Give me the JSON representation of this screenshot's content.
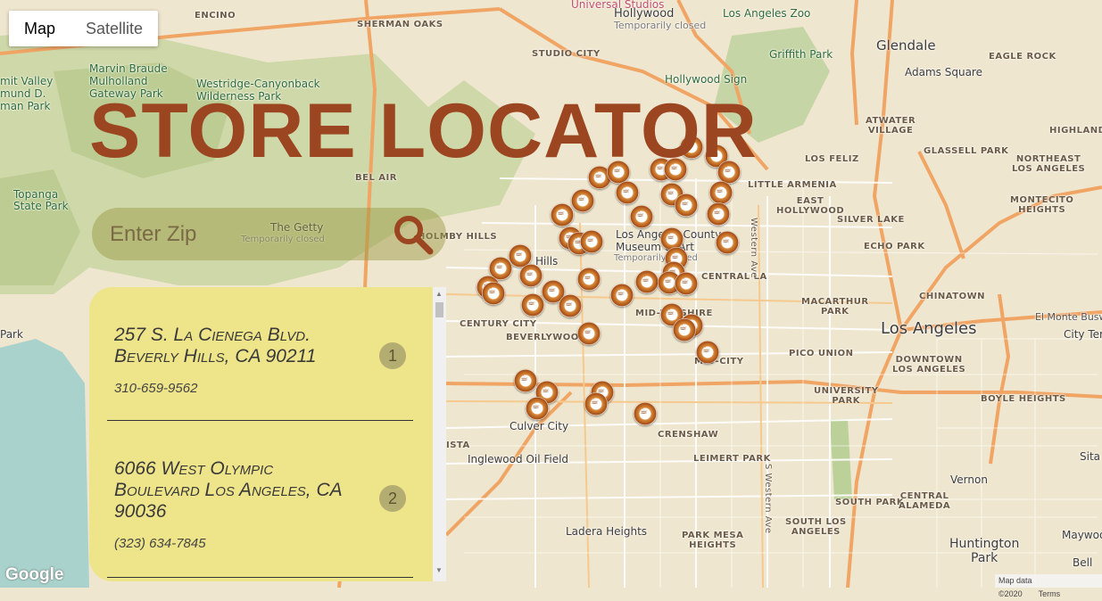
{
  "map_controls": {
    "map_label": "Map",
    "satellite_label": "Satellite"
  },
  "title": "STORE LOCATOR",
  "search": {
    "placeholder": "Enter Zip",
    "button_icon": "search-icon"
  },
  "stores": [
    {
      "address_line1": "257 S. La Cienega Blvd.",
      "address_line2": "Beverly Hills, CA 90211",
      "phone": "310-659-9562",
      "number": "1"
    },
    {
      "address_line1": "6066 West Olympic",
      "address_line2": "Boulevard Los Angeles, CA",
      "address_line3": "90036",
      "phone": "(323) 634-7845",
      "number": "2"
    }
  ],
  "map_labels": {
    "encino": "ENCINO",
    "sherman_oaks": "SHERMAN OAKS",
    "studio_city": "STUDIO CITY",
    "universal": "Universal Studios",
    "hollywood_top": "Hollywood",
    "temp_closed_1": "Temporarily closed",
    "la_zoo": "Los Angeles Zoo",
    "glendale": "Glendale",
    "eagle_rock": "EAGLE ROCK",
    "adams_square": "Adams Square",
    "griffith_park": "Griffith Park",
    "temp_closed_2": "Temporarily\nclosed",
    "hollywood_sign": "Hollywood Sign",
    "marvin_braude": "Marvin Braude\nMulholland\nGateway Park",
    "westridge": "Westridge-Canyonback\nWilderness Park",
    "summit_valley": "mit Valley\nmund D.\nman Park",
    "atwater": "ATWATER\nVILLAGE",
    "highland": "HIGHLAND",
    "glassell": "GLASSELL PARK",
    "northeast_la": "NORTHEAST\nLOS ANGELES",
    "bel_air": "BEL AIR",
    "los_feliz": "LOS FELIZ",
    "little_armenia": "LITTLE ARMENIA",
    "east_hollywood": "EAST\nHOLLYWOOD",
    "silver_lake": "SILVER LAKE",
    "montecito": "MONTECITO\nHEIGHTS",
    "topanga": "Topanga\nState Park",
    "getty": "The Getty",
    "temp_closed_3": "Temporarily closed",
    "holmby": "HOLMBY HILLS",
    "echo_park": "ECHO PARK",
    "lacma": "Los Angeles County\nMuseum of Art",
    "temp_closed_4": "Temporarily closed",
    "central_la": "CENTRAL LA",
    "western_ave": "Western Ave",
    "s_western_ave": "S Western Ave",
    "chinatown": "CHINATOWN",
    "macarthur": "MACARTHUR\nPARK",
    "century_city": "CENTURY CITY",
    "beverlywood": "BEVERLYWOOD",
    "mid_wilshire": "MID-WILSHIRE",
    "los_angeles": "Los Angeles",
    "el_monte_busway": "El Monte Busway",
    "city_terrace": "City Ter",
    "pico_union": "PICO UNION",
    "mid_city": "MID-CITY",
    "downtown": "DOWNTOWN\nLOS ANGELES",
    "university_park": "UNIVERSITY\nPARK",
    "boyle_heights": "BOYLE HEIGHTS",
    "culver_city": "Culver City",
    "crenshaw": "CRENSHAW",
    "inglewood_oil": "Inglewood Oil Field",
    "leimert": "LEIMERT PARK",
    "vernon": "Vernon",
    "south_park": "SOUTH PARK",
    "central_alameda": "CENTRAL\nALAMEDA",
    "ladera": "Ladera Heights",
    "park_mesa": "PARK MESA\nHEIGHTS",
    "south_la": "SOUTH LOS\nANGELES",
    "huntington": "Huntington\nPark",
    "maywood": "Maywoo",
    "bell": "Bell",
    "park_left": "Park",
    "hills": "Hills",
    "ista": "ISTA",
    "sita": "Sita"
  },
  "footer": {
    "google": "Google",
    "map_data": "Map data ©2020",
    "terms": "Terms"
  },
  "colors": {
    "title": "#9b4620",
    "panel": "#eee48a",
    "search_bg": "#96963c"
  }
}
